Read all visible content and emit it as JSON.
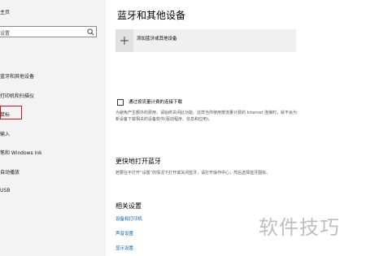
{
  "sidebar": {
    "home_label": "主页",
    "search_placeholder": "设置",
    "section_label": "",
    "items": [
      {
        "label": "蓝牙和其他设备"
      },
      {
        "label": "打印机和扫描仪"
      },
      {
        "label": "鼠标"
      },
      {
        "label": "输入"
      },
      {
        "label": "笔和 Windows Ink"
      },
      {
        "label": "自动播放"
      },
      {
        "label": "USB"
      }
    ],
    "highlight_color": "#d01616"
  },
  "main": {
    "title": "蓝牙和其他设备",
    "add_device_label": "添加蓝牙或其他设备",
    "metered": {
      "label": "通过按流量计费的连接下载",
      "checked": false,
      "description": "为避免产生额外的费用，请始终关闭此功能。这样当你使用按流量计费的 Internet 连接时，就不会为新设备下载相关的设备软件(驱动程序、信息和应用)。"
    },
    "bluetooth": {
      "title": "更快地打开蓝牙",
      "description": "若要在不打开“设置”的情况下打开或关闭蓝牙，请打开操作中心，然后选择蓝牙图标。"
    },
    "related": {
      "title": "相关设置",
      "links": [
        "设备和打印机",
        "声音设置",
        "显示设置"
      ]
    }
  },
  "watermark": "软件技巧",
  "colors": {
    "link": "#0063b1",
    "sidebar_bg": "#f3f3f3",
    "add_bg": "#f0f0f0"
  }
}
